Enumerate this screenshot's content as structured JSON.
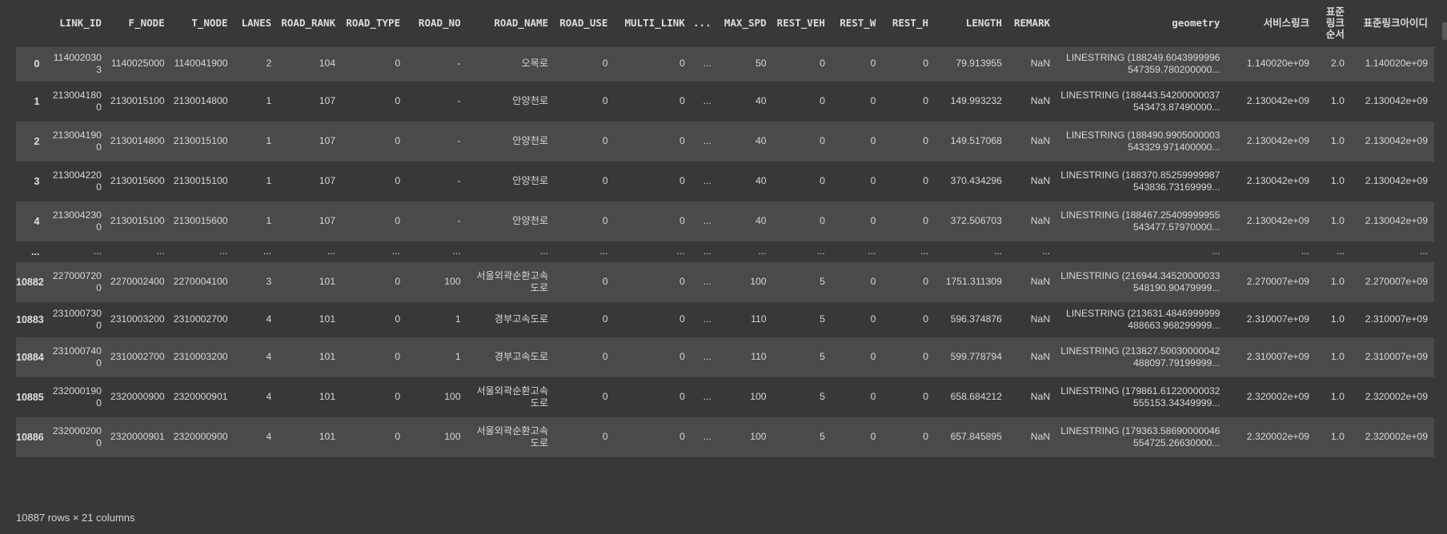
{
  "dataframe": {
    "index_header": "",
    "columns": [
      "LINK_ID",
      "F_NODE",
      "T_NODE",
      "LANES",
      "ROAD_RANK",
      "ROAD_TYPE",
      "ROAD_NO",
      "ROAD_NAME",
      "ROAD_USE",
      "MULTI_LINK",
      "...",
      "MAX_SPD",
      "REST_VEH",
      "REST_W",
      "REST_H",
      "LENGTH",
      "REMARK",
      "geometry",
      "서비스링크",
      "표준링크순서",
      "표준링크아이디"
    ],
    "rows": [
      {
        "index": "0",
        "cells": [
          "1140020303",
          "1140025000",
          "1140041900",
          "2",
          "104",
          "0",
          "-",
          "오목로",
          "0",
          "0",
          "...",
          "50",
          "0",
          "0",
          "0",
          "79.913955",
          "NaN",
          "LINESTRING (188249.6043999996 547359.780200000...",
          "1.140020e+09",
          "2.0",
          "1.140020e+09"
        ]
      },
      {
        "index": "1",
        "cells": [
          "2130041800",
          "2130015100",
          "2130014800",
          "1",
          "107",
          "0",
          "-",
          "안양천로",
          "0",
          "0",
          "...",
          "40",
          "0",
          "0",
          "0",
          "149.993232",
          "NaN",
          "LINESTRING (188443.54200000037 543473.87490000...",
          "2.130042e+09",
          "1.0",
          "2.130042e+09"
        ]
      },
      {
        "index": "2",
        "cells": [
          "2130041900",
          "2130014800",
          "2130015100",
          "1",
          "107",
          "0",
          "-",
          "안양천로",
          "0",
          "0",
          "...",
          "40",
          "0",
          "0",
          "0",
          "149.517068",
          "NaN",
          "LINESTRING (188490.9905000003 543329.971400000...",
          "2.130042e+09",
          "1.0",
          "2.130042e+09"
        ]
      },
      {
        "index": "3",
        "cells": [
          "2130042200",
          "2130015600",
          "2130015100",
          "1",
          "107",
          "0",
          "-",
          "안양천로",
          "0",
          "0",
          "...",
          "40",
          "0",
          "0",
          "0",
          "370.434296",
          "NaN",
          "LINESTRING (188370.85259999987 543836.73169999...",
          "2.130042e+09",
          "1.0",
          "2.130042e+09"
        ]
      },
      {
        "index": "4",
        "cells": [
          "2130042300",
          "2130015100",
          "2130015600",
          "1",
          "107",
          "0",
          "-",
          "안양천로",
          "0",
          "0",
          "...",
          "40",
          "0",
          "0",
          "0",
          "372.506703",
          "NaN",
          "LINESTRING (188467.25409999955 543477.57970000...",
          "2.130042e+09",
          "1.0",
          "2.130042e+09"
        ]
      },
      {
        "index": "...",
        "cells": [
          "...",
          "...",
          "...",
          "...",
          "...",
          "...",
          "...",
          "...",
          "...",
          "...",
          "...",
          "...",
          "...",
          "...",
          "...",
          "...",
          "...",
          "...",
          "...",
          "...",
          "..."
        ]
      },
      {
        "index": "10882",
        "cells": [
          "2270007200",
          "2270002400",
          "2270004100",
          "3",
          "101",
          "0",
          "100",
          "서울외곽순환고속도로",
          "0",
          "0",
          "...",
          "100",
          "5",
          "0",
          "0",
          "1751.311309",
          "NaN",
          "LINESTRING (216944.34520000033 548190.90479999...",
          "2.270007e+09",
          "1.0",
          "2.270007e+09"
        ]
      },
      {
        "index": "10883",
        "cells": [
          "2310007300",
          "2310003200",
          "2310002700",
          "4",
          "101",
          "0",
          "1",
          "경부고속도로",
          "0",
          "0",
          "...",
          "110",
          "5",
          "0",
          "0",
          "596.374876",
          "NaN",
          "LINESTRING (213631.4846999999 488663.968299999...",
          "2.310007e+09",
          "1.0",
          "2.310007e+09"
        ]
      },
      {
        "index": "10884",
        "cells": [
          "2310007400",
          "2310002700",
          "2310003200",
          "4",
          "101",
          "0",
          "1",
          "경부고속도로",
          "0",
          "0",
          "...",
          "110",
          "5",
          "0",
          "0",
          "599.778794",
          "NaN",
          "LINESTRING (213827.50030000042 488097.79199999...",
          "2.310007e+09",
          "1.0",
          "2.310007e+09"
        ]
      },
      {
        "index": "10885",
        "cells": [
          "2320001900",
          "2320000900",
          "2320000901",
          "4",
          "101",
          "0",
          "100",
          "서울외곽순환고속도로",
          "0",
          "0",
          "...",
          "100",
          "5",
          "0",
          "0",
          "658.684212",
          "NaN",
          "LINESTRING (179861.61220000032 555153.34349999...",
          "2.320002e+09",
          "1.0",
          "2.320002e+09"
        ]
      },
      {
        "index": "10886",
        "cells": [
          "2320002000",
          "2320000901",
          "2320000900",
          "4",
          "101",
          "0",
          "100",
          "서울외곽순환고속도로",
          "0",
          "0",
          "...",
          "100",
          "5",
          "0",
          "0",
          "657.845895",
          "NaN",
          "LINESTRING (179363.58690000046 554725.26630000...",
          "2.320002e+09",
          "1.0",
          "2.320002e+09"
        ]
      }
    ],
    "shape_summary": "10887 rows × 21 columns"
  }
}
